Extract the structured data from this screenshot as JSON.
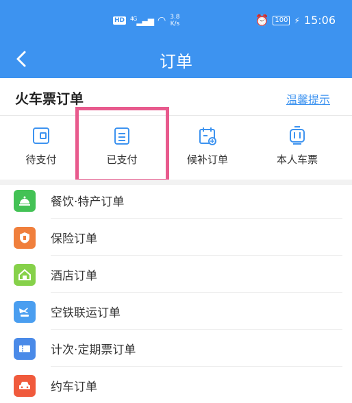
{
  "status_bar": {
    "hd": "HD",
    "network": "4G",
    "speed_value": "3.8",
    "speed_unit": "K/s",
    "battery": "100",
    "time": "15:06"
  },
  "nav": {
    "title": "订单"
  },
  "section": {
    "title": "火车票订单",
    "tips_link": "温馨提示"
  },
  "tabs": [
    {
      "label": "待支付",
      "icon": "wallet-icon"
    },
    {
      "label": "已支付",
      "icon": "receipt-icon"
    },
    {
      "label": "候补订单",
      "icon": "calendar-add-icon"
    },
    {
      "label": "本人车票",
      "icon": "train-icon"
    }
  ],
  "list": [
    {
      "label": "餐饮·特产订单",
      "icon": "food-cover-icon",
      "color": "#43c255"
    },
    {
      "label": "保险订单",
      "icon": "shield-icon",
      "color": "#f07f3c"
    },
    {
      "label": "酒店订单",
      "icon": "hotel-icon",
      "color": "#86d14a"
    },
    {
      "label": "空铁联运订单",
      "icon": "plane-train-icon",
      "color": "#4a9ef0"
    },
    {
      "label": "计次·定期票订单",
      "icon": "ticket-icon",
      "color": "#4a8ae8"
    },
    {
      "label": "约车订单",
      "icon": "car-icon",
      "color": "#f05a3c"
    }
  ],
  "colors": {
    "primary": "#3d93f0",
    "highlight": "#e85a8d"
  }
}
